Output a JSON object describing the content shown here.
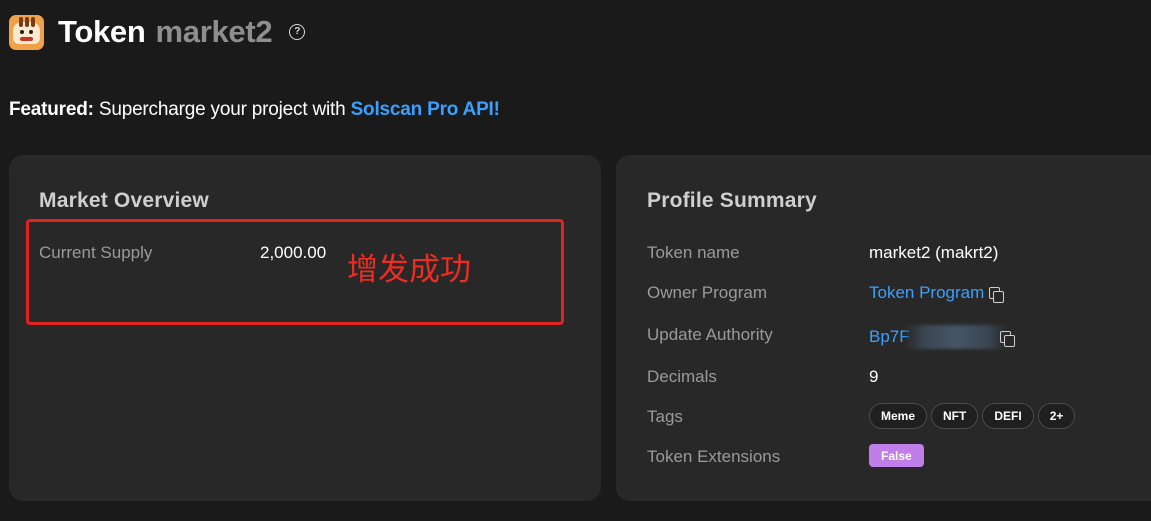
{
  "header": {
    "token_word": "Token",
    "token_name": "market2",
    "help_glyph": "?"
  },
  "featured": {
    "label": "Featured:",
    "text": " Supercharge your project with ",
    "link": "Solscan Pro API!"
  },
  "market_overview": {
    "title": "Market Overview",
    "current_supply_label": "Current Supply",
    "current_supply_value": "2,000.00",
    "annotation": "增发成功"
  },
  "profile_summary": {
    "title": "Profile Summary",
    "token_name": {
      "label": "Token name",
      "value": "market2 (makrt2)"
    },
    "owner_program": {
      "label": "Owner Program",
      "value": "Token Program"
    },
    "update_authority": {
      "label": "Update Authority",
      "value": "Bp7F"
    },
    "decimals": {
      "label": "Decimals",
      "value": "9"
    },
    "tags": {
      "label": "Tags",
      "items": [
        "Meme",
        "NFT",
        "DEFI",
        "2+"
      ]
    },
    "token_extensions": {
      "label": "Token Extensions",
      "value": "False"
    }
  },
  "colors": {
    "background": "#1a1a1a",
    "card": "#282828",
    "link": "#3aa0ff",
    "annotation": "#e0231c",
    "badge": "#c07ee8"
  },
  "icons": [
    "tiger-logo-icon",
    "help-icon",
    "copy-icon"
  ]
}
